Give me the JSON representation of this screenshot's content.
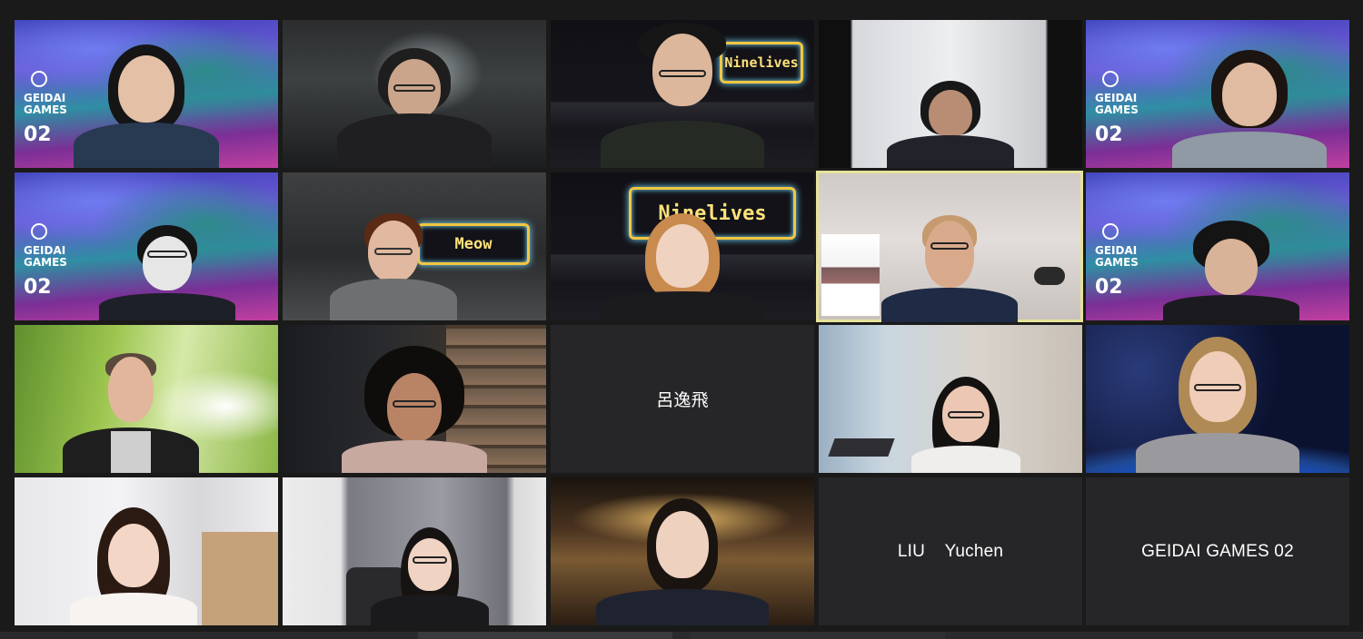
{
  "app": {
    "view": "gallery"
  },
  "participants": [
    {
      "name": "",
      "background": "geidai-icon",
      "overlay_title": "GEIDAI\nGAMES",
      "overlay_number": "02"
    },
    {
      "name": "",
      "background": "dark-room"
    },
    {
      "name": "",
      "background": "ninelives-neon",
      "sign_text": "Ninelives"
    },
    {
      "name": "",
      "background": "window-office"
    },
    {
      "name": "",
      "background": "geidai-icon",
      "overlay_title": "GEIDAI\nGAMES",
      "overlay_number": "02"
    },
    {
      "name": "",
      "background": "geidai-icon",
      "overlay_title": "GEIDAI\nGAMES",
      "overlay_number": "02"
    },
    {
      "name": "",
      "background": "meow-neon",
      "sign_text": "Meow"
    },
    {
      "name": "",
      "background": "ninelives-neon",
      "sign_text": "Ninelives"
    },
    {
      "name": "",
      "background": "office-bookshelf",
      "active_speaker": true
    },
    {
      "name": "",
      "background": "geidai-icon",
      "overlay_title": "GEIDAI\nGAMES",
      "overlay_number": "02"
    },
    {
      "name": "",
      "background": "grass"
    },
    {
      "name": "",
      "background": "library"
    },
    {
      "name": "呂逸飛",
      "video_off": true
    },
    {
      "name": "",
      "background": "bright-room"
    },
    {
      "name": "",
      "background": "space-earth"
    },
    {
      "name": "",
      "background": "white-curtain"
    },
    {
      "name": "",
      "background": "grey-curtain"
    },
    {
      "name": "",
      "background": "theatre"
    },
    {
      "name": "LIU    Yuchen",
      "video_off": true
    },
    {
      "name": "GEIDAI GAMES 02",
      "video_off": true
    }
  ],
  "colors": {
    "window_bg": "#1a1a1a",
    "tile_off_bg": "#262628",
    "active_speaker_border": "#e6e29a",
    "name_text": "#ffffff"
  }
}
